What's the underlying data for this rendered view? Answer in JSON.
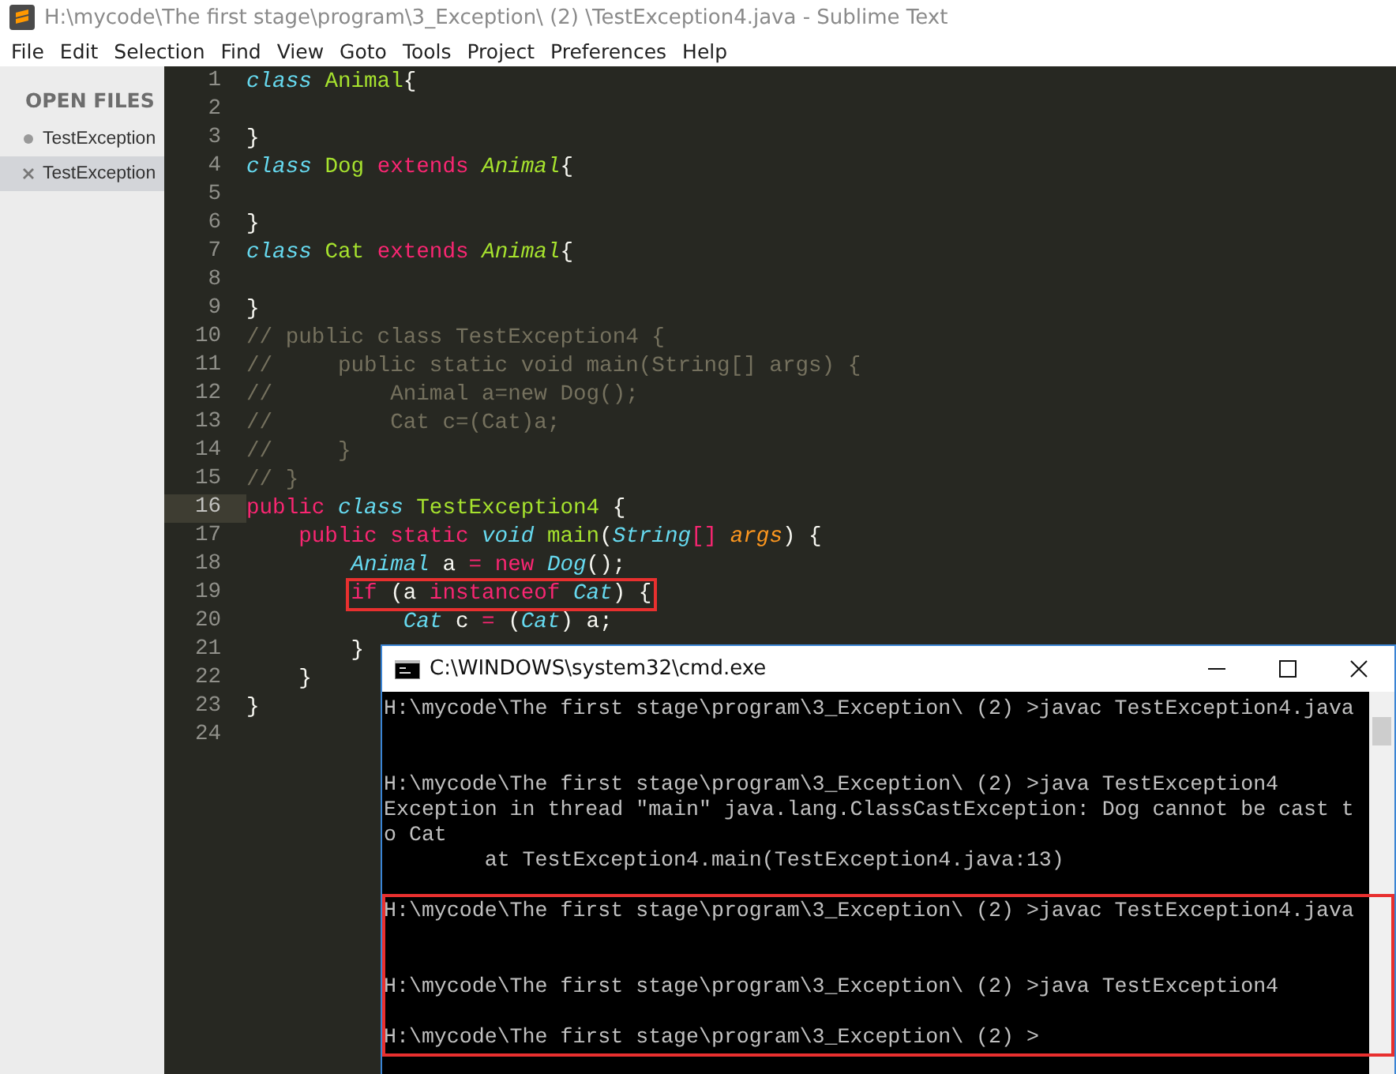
{
  "window": {
    "title": "H:\\mycode\\The first stage\\program\\3_Exception\\ (2) \\TestException4.java - Sublime Text"
  },
  "menu": [
    "File",
    "Edit",
    "Selection",
    "Find",
    "View",
    "Goto",
    "Tools",
    "Project",
    "Preferences",
    "Help"
  ],
  "sidebar": {
    "heading": "OPEN FILES",
    "items": [
      {
        "label": "TestException",
        "selected": false
      },
      {
        "label": "TestException",
        "selected": true
      }
    ]
  },
  "editor": {
    "lines": [
      {
        "number": "1",
        "tokens": [
          {
            "kind": "storage",
            "text": "class "
          },
          {
            "kind": "entity",
            "text": "Animal"
          },
          {
            "kind": "plain",
            "text": "{"
          }
        ]
      },
      {
        "number": "2"
      },
      {
        "number": "3",
        "tokens": [
          {
            "kind": "plain",
            "text": "}"
          }
        ]
      },
      {
        "number": "4",
        "tokens": [
          {
            "kind": "storage",
            "text": "class "
          },
          {
            "kind": "entity",
            "text": "Dog "
          },
          {
            "kind": "keyword",
            "text": "extends "
          },
          {
            "kind": "inherited",
            "text": "Animal"
          },
          {
            "kind": "plain",
            "text": "{"
          }
        ]
      },
      {
        "number": "5"
      },
      {
        "number": "6",
        "tokens": [
          {
            "kind": "plain",
            "text": "}"
          }
        ]
      },
      {
        "number": "7",
        "tokens": [
          {
            "kind": "storage",
            "text": "class "
          },
          {
            "kind": "entity",
            "text": "Cat "
          },
          {
            "kind": "keyword",
            "text": "extends "
          },
          {
            "kind": "inherited",
            "text": "Animal"
          },
          {
            "kind": "plain",
            "text": "{"
          }
        ]
      },
      {
        "number": "8"
      },
      {
        "number": "9",
        "tokens": [
          {
            "kind": "plain",
            "text": "}"
          }
        ]
      },
      {
        "number": "10",
        "tokens": [
          {
            "kind": "comment",
            "text": "// public class TestException4 {"
          }
        ]
      },
      {
        "number": "11",
        "tokens": [
          {
            "kind": "comment",
            "text": "//     public static void main(String[] args) {"
          }
        ]
      },
      {
        "number": "12",
        "tokens": [
          {
            "kind": "comment",
            "text": "//         Animal a=new Dog();"
          }
        ]
      },
      {
        "number": "13",
        "tokens": [
          {
            "kind": "comment",
            "text": "//         Cat c=(Cat)a;"
          }
        ]
      },
      {
        "number": "14",
        "tokens": [
          {
            "kind": "comment",
            "text": "//     }"
          }
        ]
      },
      {
        "number": "15",
        "tokens": [
          {
            "kind": "comment",
            "text": "// }"
          }
        ]
      },
      {
        "number": "16",
        "current": true,
        "tokens": [
          {
            "kind": "keyword",
            "text": "public "
          },
          {
            "kind": "storage",
            "text": "class "
          },
          {
            "kind": "entity",
            "text": "TestException4"
          },
          {
            "kind": "plain",
            "text": " {"
          }
        ],
        "children": [
          {
            "number": "17",
            "tokens": [
              {
                "kind": "keyword",
                "text": "public static "
              },
              {
                "kind": "storage",
                "text": "void "
              },
              {
                "kind": "entity",
                "text": "main"
              },
              {
                "kind": "plain",
                "text": "("
              },
              {
                "kind": "storage",
                "text": "String"
              },
              {
                "kind": "keyword",
                "text": "[] "
              },
              {
                "kind": "param",
                "text": "args"
              },
              {
                "kind": "plain",
                "text": ") {"
              }
            ],
            "children": [
              {
                "number": "18",
                "tokens": [
                  {
                    "kind": "storage",
                    "text": "Animal"
                  },
                  {
                    "kind": "plain",
                    "text": " a "
                  },
                  {
                    "kind": "keyword",
                    "text": "= new "
                  },
                  {
                    "kind": "storage",
                    "text": "Dog"
                  },
                  {
                    "kind": "plain",
                    "text": "();"
                  }
                ]
              },
              {
                "number": "19",
                "boxed": true,
                "tokens": [
                  {
                    "kind": "keyword",
                    "text": "if"
                  },
                  {
                    "kind": "plain",
                    "text": " (a "
                  },
                  {
                    "kind": "keyword",
                    "text": "instanceof "
                  },
                  {
                    "kind": "storage",
                    "text": "Cat"
                  },
                  {
                    "kind": "plain",
                    "text": ") {"
                  }
                ],
                "children": [
                  {
                    "number": "20",
                    "tokens": [
                      {
                        "kind": "storage",
                        "text": "Cat"
                      },
                      {
                        "kind": "plain",
                        "text": " c "
                      },
                      {
                        "kind": "keyword",
                        "text": "= "
                      },
                      {
                        "kind": "plain",
                        "text": "("
                      },
                      {
                        "kind": "storage",
                        "text": "Cat"
                      },
                      {
                        "kind": "plain",
                        "text": ") a;"
                      }
                    ]
                  }
                ]
              },
              {
                "number": "21",
                "tokens": [
                  {
                    "kind": "plain",
                    "text": "}"
                  }
                ]
              }
            ]
          },
          {
            "number": "22",
            "tokens": [
              {
                "kind": "plain",
                "text": "}"
              }
            ]
          }
        ]
      },
      {
        "number": "23",
        "tokens": [
          {
            "kind": "plain",
            "text": "}"
          }
        ]
      },
      {
        "number": "24"
      }
    ]
  },
  "console": {
    "title": "C:\\WINDOWS\\system32\\cmd.exe",
    "groups": [
      {
        "boxed": false,
        "lines": [
          {
            "kind": "output",
            "text": "H:\\mycode\\The first stage\\program\\3_Exception\\ (2) >javac TestException4.java"
          },
          {
            "kind": "blank"
          },
          {
            "kind": "blank"
          },
          {
            "kind": "output",
            "text": "H:\\mycode\\The first stage\\program\\3_Exception\\ (2) >java TestException4"
          },
          {
            "kind": "output",
            "text": "Exception in thread \"main\" java.lang.ClassCastException: Dog cannot be cast t"
          },
          {
            "kind": "output",
            "text": "o Cat"
          },
          {
            "kind": "output",
            "text": "        at TestException4.main(TestException4.java:13)"
          },
          {
            "kind": "blank"
          }
        ]
      },
      {
        "boxed": true,
        "lines": [
          {
            "kind": "output",
            "text": "H:\\mycode\\The first stage\\program\\3_Exception\\ (2) >javac TestException4.java"
          },
          {
            "kind": "blank"
          },
          {
            "kind": "blank"
          },
          {
            "kind": "output",
            "text": "H:\\mycode\\The first stage\\program\\3_Exception\\ (2) >java TestException4"
          },
          {
            "kind": "blank"
          },
          {
            "kind": "output",
            "text": "H:\\mycode\\The first stage\\program\\3_Exception\\ (2) >"
          }
        ]
      }
    ]
  }
}
